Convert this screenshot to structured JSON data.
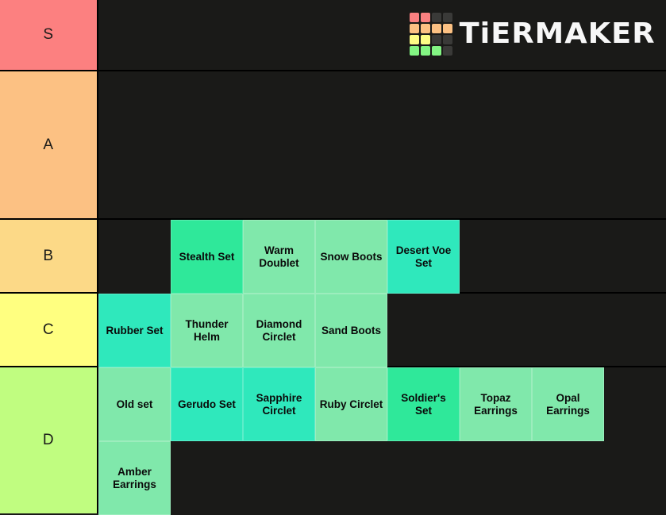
{
  "app": {
    "name": "TierMaker",
    "logo_text": "TiERMAKER",
    "background_color": "#1a1a18",
    "logo_grid_colors": [
      "#f98080",
      "#f98080",
      "#3a3a38",
      "#3a3a38",
      "#fcc183",
      "#fcc183",
      "#fcc183",
      "#fcc183",
      "#fdfd85",
      "#fdfd85",
      "#3a3a38",
      "#3a3a38",
      "#83f583",
      "#83f583",
      "#83f583",
      "#3a3a38"
    ]
  },
  "tiers": [
    {
      "label": "S",
      "color": "#fc8080",
      "leading_spacers": 0,
      "items": []
    },
    {
      "label": "A",
      "color": "#fcc183",
      "leading_spacers": 0,
      "items": []
    },
    {
      "label": "B",
      "color": "#fcd987",
      "leading_spacers": 1,
      "items": [
        {
          "label": "Stealth Set",
          "color": "#2fe89a"
        },
        {
          "label": "Warm Doublet",
          "color": "#80e8ab"
        },
        {
          "label": "Snow Boots",
          "color": "#80e8ab"
        },
        {
          "label": "Desert Voe Set",
          "color": "#2fe8bc"
        }
      ]
    },
    {
      "label": "C",
      "color": "#ffff80",
      "leading_spacers": 0,
      "items": [
        {
          "label": "Rubber Set",
          "color": "#2fe8bc"
        },
        {
          "label": "Thunder Helm",
          "color": "#80e8ab"
        },
        {
          "label": "Diamond Circlet",
          "color": "#80e8ab"
        },
        {
          "label": "Sand Boots",
          "color": "#80e8ab"
        }
      ]
    },
    {
      "label": "D",
      "color": "#c0fd80",
      "leading_spacers": 0,
      "items": [
        {
          "label": "Old set",
          "color": "#80e8ab"
        },
        {
          "label": "Gerudo Set",
          "color": "#2fe8bc"
        },
        {
          "label": "Sapphire Circlet",
          "color": "#2fe8bc"
        },
        {
          "label": "Ruby Circlet",
          "color": "#80e8ab"
        },
        {
          "label": "Soldier's Set",
          "color": "#2fe89a"
        },
        {
          "label": "Topaz Earrings",
          "color": "#80e8ab"
        },
        {
          "label": "Opal Earrings",
          "color": "#80e8ab"
        },
        {
          "label": "Amber Earrings",
          "color": "#80e8ab"
        }
      ]
    }
  ]
}
